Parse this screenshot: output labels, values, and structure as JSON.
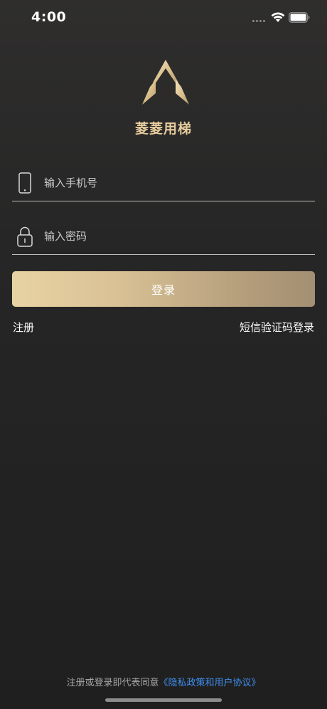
{
  "status_bar": {
    "time": "4:00"
  },
  "brand": {
    "name": "菱菱用梯",
    "color": "#e6cc9d"
  },
  "phone_field": {
    "placeholder": "输入手机号",
    "value": "",
    "icon": "phone-icon"
  },
  "password_field": {
    "placeholder": "输入密码",
    "value": "",
    "icon": "lock-icon"
  },
  "login_button": {
    "label": "登录"
  },
  "links": {
    "register": "注册",
    "sms_login": "短信验证码登录"
  },
  "agreement": {
    "prefix": "注册或登录即代表同意",
    "policy_link": "《隐私政策和用户协议》"
  },
  "colors": {
    "background": "#262626",
    "accent_gold": "#e6cc9d",
    "link_blue": "#3f8ff0"
  }
}
